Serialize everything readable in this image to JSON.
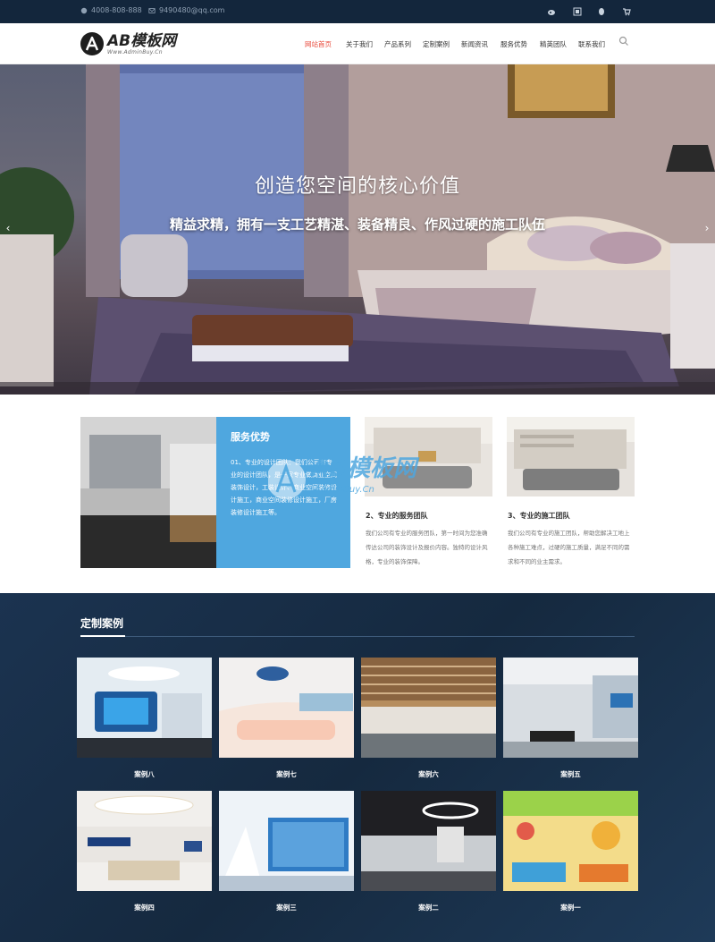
{
  "topbar": {
    "phone": "4008-808-888",
    "email": "9490480@qq.com",
    "icons": [
      "weibo-icon",
      "wechat-icon",
      "qq-icon",
      "cart-icon"
    ]
  },
  "header": {
    "logo_title": "AB模板网",
    "logo_sub": "Www.AdminBuy.Cn",
    "nav": [
      "网站首页",
      "关于我们",
      "产品系列",
      "定制案例",
      "新闻资讯",
      "服务优势",
      "精英团队",
      "联系我们"
    ],
    "active_nav": "网站首页",
    "accent_color": "#e8483a"
  },
  "hero": {
    "title": "创造您空间的核心价值",
    "subtitle": "精益求精，拥有一支工艺精湛、装备精良、作风过硬的施工队伍",
    "prev_arrow": "‹",
    "next_arrow": "›"
  },
  "services": {
    "blue_title": "服务优势",
    "blue_text": "01、专业的设计团队：我们公司有专业的设计团队，是一家专业做商业空间装饰设计，工装设计、商业空间装修设计施工，商业空间装修设计施工，厂房装修设计施工等。",
    "cards": [
      {
        "title": "2、专业的服务团队",
        "text": "我们公司有专业的服务团队，第一时间为您准确传达公司的装饰设计及报价内容。独特的设计风格，专业的装饰保障。"
      },
      {
        "title": "3、专业的施工团队",
        "text": "我们公司有专业的施工团队，帮助您解决工地上各种施工难点，过硬的施工质量，满足不同的需求和不同的业主需求。"
      }
    ],
    "blue_color": "#4fa7df"
  },
  "watermark": {
    "text": "AB模板网",
    "sub": "AdminBuy.Cn"
  },
  "cases": {
    "title": "定制案例",
    "items": [
      "案例八",
      "案例七",
      "案例六",
      "案例五",
      "案例四",
      "案例三",
      "案例二",
      "案例一"
    ],
    "bg_color": "#15293f"
  }
}
